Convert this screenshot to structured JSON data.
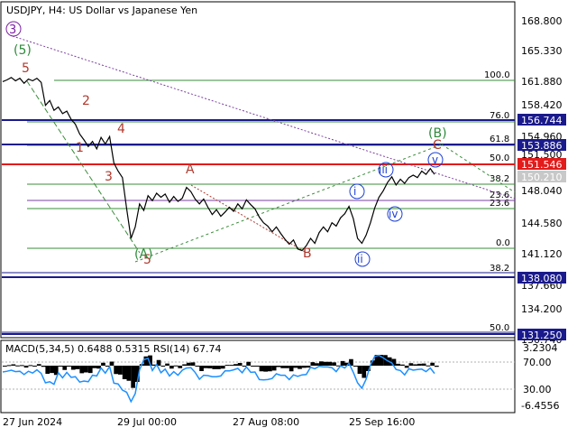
{
  "chart_title": "USDJPY, H4:  US Dollar vs Japanese Yen",
  "price_axis": {
    "ticks": [
      "168.800",
      "165.330",
      "161.880",
      "158.420",
      "154.960",
      "151.500",
      "148.040",
      "144.580",
      "141.120",
      "137.660",
      "134.200",
      "130.740"
    ],
    "range": [
      130.0,
      171.0
    ]
  },
  "price_tags": [
    {
      "label": "156.744",
      "value": 156.744,
      "color": "#1a1a8c"
    },
    {
      "label": "153.886",
      "value": 153.886,
      "color": "#1a1a8c"
    },
    {
      "label": "151.546",
      "value": 151.546,
      "color": "#e21b1b"
    },
    {
      "label": "150.210",
      "value": 150.21,
      "color": "#c8c8c8"
    },
    {
      "label": "138.080",
      "value": 138.08,
      "color": "#1a1a8c"
    },
    {
      "label": "131.250",
      "value": 131.25,
      "color": "#1a1a8c"
    }
  ],
  "fib_labels": [
    {
      "label": "100.0",
      "value": 161.88,
      "side": "right"
    },
    {
      "label": "76.0",
      "value": 157.3,
      "side": "right"
    },
    {
      "label": "61.8",
      "value": 154.65,
      "side": "right"
    },
    {
      "label": "50.0",
      "value": 152.45,
      "side": "right"
    },
    {
      "label": "38.2",
      "value": 150.25,
      "side": "right"
    },
    {
      "label": "23.6",
      "value": 147.5,
      "side": "right"
    },
    {
      "label": "23.6",
      "value": 146.6,
      "side": "right"
    },
    {
      "label": "0.0",
      "value": 142.4,
      "side": "right"
    },
    {
      "label": "38.2",
      "value": 138.6,
      "side": "right"
    },
    {
      "label": "50.0",
      "value": 132.0,
      "side": "right"
    }
  ],
  "time_axis": [
    "27 Jun 2024",
    "29 Jul 00:00",
    "27 Aug 08:00",
    "25 Sep 16:00"
  ],
  "indicator_title": "MACD(5,34,5) 0.6488 0.5315 RSI(14) 67.74",
  "indicator_axis": [
    "3.2304",
    "70.00",
    "30.00",
    "-6.4556"
  ],
  "wave_labels": {
    "red": [
      "5",
      "2",
      "1",
      "4",
      "3",
      "5",
      "A",
      "B",
      "C"
    ],
    "green": [
      "(5)",
      "(A)",
      "(B)"
    ],
    "purple": [
      "3"
    ],
    "blue": [
      "i",
      "ii",
      "iii",
      "iv",
      "v"
    ]
  },
  "chart_data": {
    "type": "line",
    "title": "USDJPY, H4:  US Dollar vs Japanese Yen",
    "x": [
      "27 Jun 2024",
      "29 Jul 00:00",
      "27 Aug 08:00",
      "25 Sep 16:00"
    ],
    "price_series": [
      161.5,
      161.7,
      162.0,
      161.6,
      161.9,
      161.3,
      161.8,
      161.6,
      161.9,
      161.4,
      158.6,
      159.2,
      158.0,
      158.4,
      157.6,
      157.9,
      156.9,
      156.3,
      155.1,
      154.4,
      153.6,
      154.2,
      153.3,
      154.7,
      153.9,
      154.8,
      151.6,
      150.6,
      149.8,
      146.0,
      142.4,
      143.8,
      146.6,
      145.8,
      147.6,
      147.0,
      147.9,
      147.4,
      147.8,
      146.8,
      147.5,
      146.9,
      147.3,
      148.6,
      148.1,
      147.2,
      146.6,
      147.2,
      146.2,
      145.3,
      145.9,
      145.1,
      145.6,
      146.2,
      145.7,
      146.6,
      146.0,
      147.1,
      146.5,
      146.0,
      145.0,
      144.3,
      143.9,
      143.2,
      143.8,
      143.0,
      142.3,
      141.7,
      142.2,
      141.1,
      140.9,
      141.5,
      142.4,
      141.8,
      143.1,
      143.8,
      143.2,
      144.3,
      143.9,
      144.9,
      145.4,
      146.3,
      144.8,
      142.4,
      141.8,
      142.8,
      144.3,
      146.1,
      147.4,
      148.2,
      149.2,
      149.9,
      148.9,
      149.6,
      149.1,
      149.8,
      150.1,
      149.8,
      150.6,
      150.2,
      150.9,
      150.2
    ],
    "ylim": [
      130.0,
      171.0
    ],
    "indicator": {
      "name": "MACD(5,34,5) 0.6488 0.5315 RSI(14) 67.74",
      "macd": 0.6488,
      "signal": 0.5315,
      "rsi": 67.74,
      "ylim": [
        -6.4556,
        3.2304
      ]
    }
  }
}
